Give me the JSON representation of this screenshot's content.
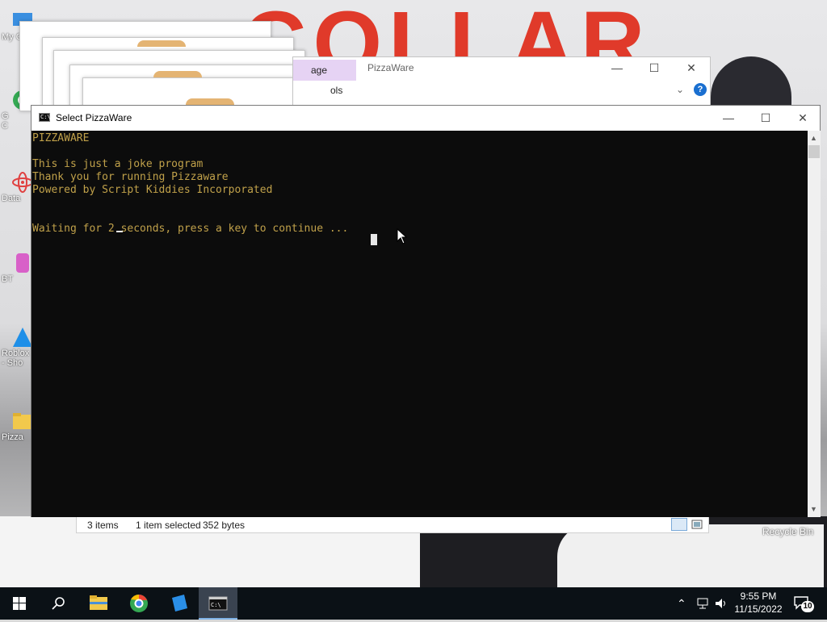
{
  "wallpaper": {
    "banner_text": "COLLAR"
  },
  "desktop": {
    "icons": [
      {
        "label": "My C",
        "icon": "computer-icon"
      },
      {
        "label": "G\nC",
        "icon": "chrome-icon"
      },
      {
        "label": "Data",
        "icon": "atom-icon"
      },
      {
        "label": "BT",
        "icon": "app-icon"
      },
      {
        "label": "Roblox\n- Sho",
        "icon": "roblox-icon"
      },
      {
        "label": "Pizza",
        "icon": "folder-icon"
      }
    ],
    "recycle_bin": "Recycle Bin"
  },
  "explorer": {
    "tab_label": "age",
    "tab2_label": "ols",
    "title": "PizzaWare",
    "status": {
      "items": "3 items",
      "selected": "1 item selected",
      "size": "352 bytes"
    }
  },
  "console": {
    "title": "Select PizzaWare",
    "icon_text": "C:\\",
    "lines": [
      "PIZZAWARE",
      "",
      "This is just a joke program",
      "Thank you for running Pizzaware",
      "Powered by Script Kiddies Incorporated",
      "",
      "",
      "Waiting for 2 seconds, press a key to continue ..."
    ]
  },
  "taskbar": {
    "clock_time": "9:55 PM",
    "clock_date": "11/15/2022",
    "notification_count": "10"
  },
  "colors": {
    "console_text": "#c0a14a",
    "console_bg": "#0c0c0c",
    "taskbar_bg": "#0b1116",
    "accent": "#7fb2e6"
  }
}
